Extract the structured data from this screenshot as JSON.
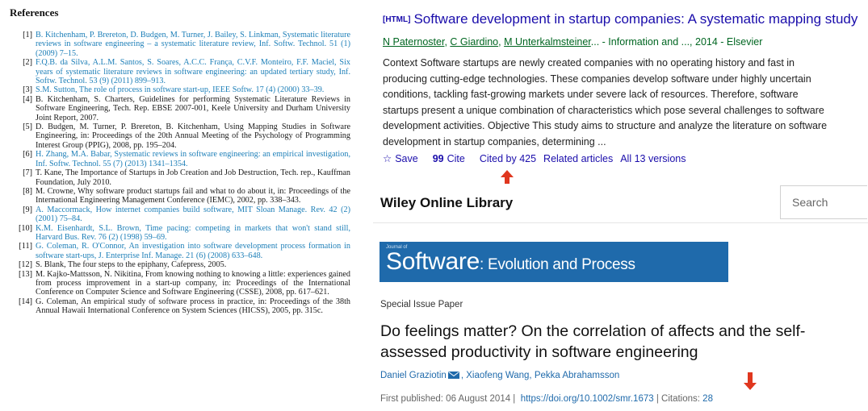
{
  "references": {
    "title": "References",
    "items": [
      {
        "num": "[1]",
        "text": "B. Kitchenham, P. Brereton, D. Budgen, M. Turner, J. Bailey, S. Linkman, Systematic literature reviews in software engineering – a systematic literature review, Inf. Softw. Technol. 51 (1) (2009) 7–15.",
        "linked": true
      },
      {
        "num": "[2]",
        "text": "F.Q.B. da Silva, A.L.M. Santos, S. Soares, A.C.C. França, C.V.F. Monteiro, F.F. Maciel, Six years of systematic literature reviews in software engineering: an updated tertiary study, Inf. Softw. Technol. 53 (9) (2011) 899–913.",
        "linked": true
      },
      {
        "num": "[3]",
        "text": "S.M. Sutton, The role of process in software start-up, IEEE Softw. 17 (4) (2000) 33–39.",
        "linked": true
      },
      {
        "num": "[4]",
        "text": "B. Kitchenham, S. Charters, Guidelines for performing Systematic Literature Reviews in Software Engineering, Tech. Rep. EBSE 2007-001, Keele University and Durham University Joint Report, 2007.",
        "linked": false
      },
      {
        "num": "[5]",
        "text": "D. Budgen, M. Turner, P. Brereton, B. Kitchenham, Using Mapping Studies in Software Engineering, in: Proceedings of the 20th Annual Meeting of the Psychology of Programming Interest Group (PPIG), 2008, pp. 195–204.",
        "linked": false
      },
      {
        "num": "[6]",
        "text": "H. Zhang, M.A. Babar, Systematic reviews in software engineering: an empirical investigation, Inf. Softw. Technol. 55 (7) (2013) 1341–1354.",
        "linked": true
      },
      {
        "num": "[7]",
        "text": "T. Kane, The Importance of Startups in Job Creation and Job Destruction, Tech. rep., Kauffman Foundation, July 2010.",
        "linked": false
      },
      {
        "num": "[8]",
        "text": "M. Crowne, Why software product startups fail and what to do about it, in: Proceedings of the International Engineering Management Conference (IEMC), 2002, pp. 338–343.",
        "linked": false
      },
      {
        "num": "[9]",
        "text": "A. Maccormack, How internet companies build software, MIT Sloan Manage. Rev. 42 (2) (2001) 75–84.",
        "linked": true
      },
      {
        "num": "[10]",
        "text": "K.M. Eisenhardt, S.L. Brown, Time pacing: competing in markets that won't stand still, Harvard Bus. Rev. 76 (2) (1998) 59–69.",
        "linked": true
      },
      {
        "num": "[11]",
        "text": "G. Coleman, R. O'Connor, An investigation into software development process formation in software start-ups, J. Enterprise Inf. Manage. 21 (6) (2008) 633–648.",
        "linked": true
      },
      {
        "num": "[12]",
        "text": "S. Blank, The four steps to the epiphany, Cafepress, 2005.",
        "linked": false
      },
      {
        "num": "[13]",
        "text": "M. Kajko-Mattsson, N. Nikitina, From knowing nothing to knowing a little: experiences gained from process improvement in a start-up company, in: Proceedings of the International Conference on Computer Science and Software Engineering (CSSE), 2008, pp. 617–621.",
        "linked": false
      },
      {
        "num": "[14]",
        "text": "G. Coleman, An empirical study of software process in practice, in: Proceedings of the 38th Annual Hawaii International Conference on System Sciences (HICSS), 2005, pp. 315c.",
        "linked": false
      }
    ]
  },
  "scholar": {
    "tag": "[HTML]",
    "title": "Software development in startup companies: A systematic mapping study",
    "authors": [
      "N Paternoster",
      "C Giardino",
      "M Unterkalmsteiner"
    ],
    "authors_rest": "... - Information and ..., 2014 - Elsevier",
    "snippet": "Context Software startups are newly created companies with no operating history and fast in producing cutting-edge technologies. These companies develop software under highly uncertain conditions, tackling fast-growing markets under severe lack of resources. Therefore, software startups present a unique combination of characteristics which pose several challenges to software development activities. Objective This study aims to structure and analyze the literature on software development in startup companies, determining ...",
    "actions": {
      "save": "Save",
      "cite": "Cite",
      "cited_by": "Cited by 425",
      "related": "Related articles",
      "versions": "All 13 versions"
    }
  },
  "wiley": {
    "brand": "Wiley Online Library",
    "search_placeholder": "Search",
    "journal_small": "Journal of",
    "journal_big": "Software",
    "journal_rest": ": Evolution and Process",
    "special": "Special Issue Paper",
    "title": "Do feelings matter? On the correlation of affects and the self-assessed productivity in software engineering",
    "author1": "Daniel Graziotin",
    "authors_rest": ", Xiaofeng Wang, Pekka Abrahamsson",
    "published": "First published: 06 August 2014",
    "doi": "https://doi.org/10.1002/smr.1673",
    "citations_label": "Citations:",
    "citations_count": "28"
  },
  "colors": {
    "arrow": "#e0371f",
    "scholar_link": "#1a0dab",
    "scholar_green": "#006621",
    "wiley_blue": "#1f6aab",
    "ref_link": "#1d7fb8"
  }
}
